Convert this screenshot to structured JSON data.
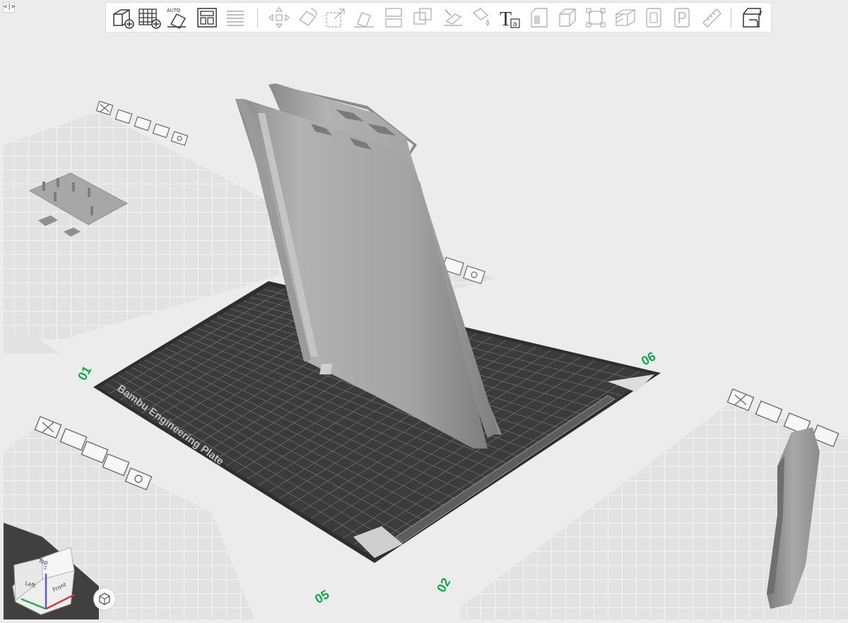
{
  "toolbar": {
    "text_label_glyph": "T",
    "text_label_sub": "a",
    "auto_label": "AUTO",
    "buttons": [
      {
        "name": "add-object-icon",
        "enabled": true
      },
      {
        "name": "add-plate-icon",
        "enabled": true
      },
      {
        "name": "auto-orient-icon",
        "enabled": true
      },
      {
        "name": "arrange-icon",
        "enabled": true
      },
      {
        "name": "split-to-parts-icon",
        "enabled": false
      },
      {
        "name": "move-icon",
        "enabled": false
      },
      {
        "name": "rotate-icon",
        "enabled": false
      },
      {
        "name": "scale-icon",
        "enabled": false
      },
      {
        "name": "lay-on-face-icon",
        "enabled": false
      },
      {
        "name": "cut-icon",
        "enabled": false
      },
      {
        "name": "boolean-icon",
        "enabled": false
      },
      {
        "name": "support-paint-icon",
        "enabled": false
      },
      {
        "name": "color-paint-icon",
        "enabled": false
      },
      {
        "name": "text-icon",
        "enabled": true
      },
      {
        "name": "emboss-icon",
        "enabled": false
      },
      {
        "name": "mesh-icon",
        "enabled": false
      },
      {
        "name": "fit-icon",
        "enabled": false
      },
      {
        "name": "variable-layer-icon",
        "enabled": false
      },
      {
        "name": "seam-icon",
        "enabled": false
      },
      {
        "name": "p-icon",
        "enabled": false
      },
      {
        "name": "measure-icon",
        "enabled": false
      },
      {
        "name": "assembly-view-icon",
        "enabled": true
      }
    ]
  },
  "plate": {
    "label": "Bambu Engineering Plate",
    "index_labels": [
      "01",
      "02",
      "05",
      "06"
    ]
  },
  "nav_cube": {
    "top": "Top",
    "left": "Left",
    "front": "Front",
    "axis_z": "Z"
  },
  "colors": {
    "background": "#ececec",
    "grid_plate": "#e2e2e2",
    "build_plate": "#3a3a3a",
    "model": "#a0a0a0",
    "plate_number": "#12a84e"
  }
}
